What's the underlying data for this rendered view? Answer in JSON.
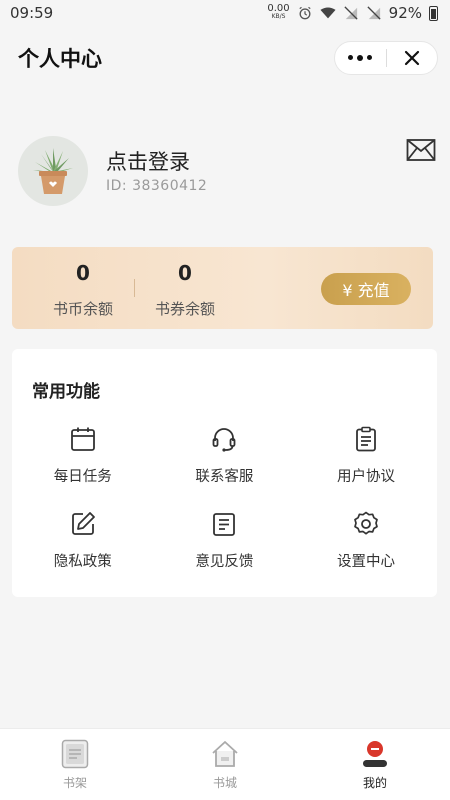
{
  "status_bar": {
    "time": "09:59",
    "net_speed": "0.00",
    "net_unit": "KB/S",
    "battery": "92%"
  },
  "header": {
    "title": "个人中心"
  },
  "profile": {
    "login_text": "点击登录",
    "user_id": "ID:  38360412"
  },
  "wallet": {
    "coins_value": "0",
    "coins_label": "书币余额",
    "vouchers_value": "0",
    "vouchers_label": "书券余额",
    "recharge_label": "¥ 充值"
  },
  "functions": {
    "title": "常用功能",
    "items": [
      {
        "label": "每日任务",
        "icon": "calendar-icon"
      },
      {
        "label": "联系客服",
        "icon": "headset-icon"
      },
      {
        "label": "用户协议",
        "icon": "clipboard-icon"
      },
      {
        "label": "隐私政策",
        "icon": "edit-icon"
      },
      {
        "label": "意见反馈",
        "icon": "document-icon"
      },
      {
        "label": "设置中心",
        "icon": "gear-icon"
      }
    ]
  },
  "tabbar": {
    "items": [
      {
        "label": "书架",
        "icon": "bookshelf-icon",
        "active": false
      },
      {
        "label": "书城",
        "icon": "bookstore-icon",
        "active": false
      },
      {
        "label": "我的",
        "icon": "profile-icon",
        "active": true
      }
    ]
  },
  "colors": {
    "wallet_bg": "#f4dcc2",
    "recharge_button": "#c9a04e",
    "active_tab_accent": "#d9372b"
  }
}
